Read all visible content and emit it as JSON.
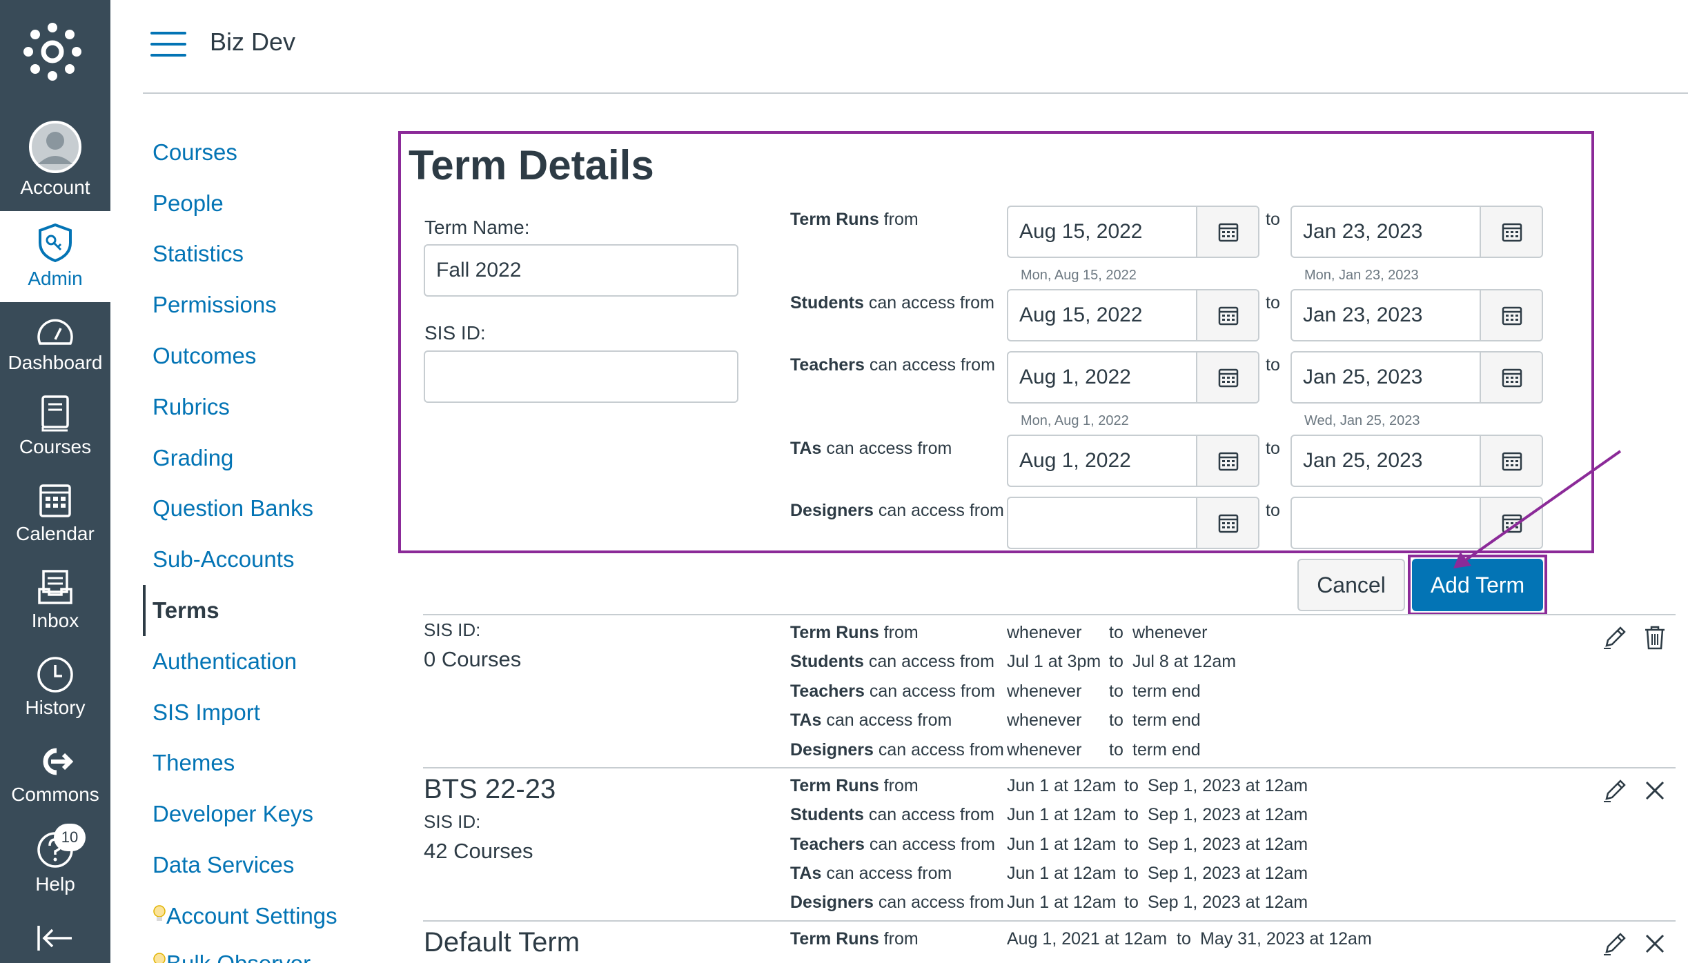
{
  "global_nav": {
    "items": [
      {
        "label": "Account",
        "icon": "user-avatar-icon"
      },
      {
        "label": "Admin",
        "icon": "admin-shield-icon",
        "active": true
      },
      {
        "label": "Dashboard",
        "icon": "dashboard-icon"
      },
      {
        "label": "Courses",
        "icon": "book-icon"
      },
      {
        "label": "Calendar",
        "icon": "calendar-icon"
      },
      {
        "label": "Inbox",
        "icon": "inbox-icon"
      },
      {
        "label": "History",
        "icon": "clock-icon"
      },
      {
        "label": "Commons",
        "icon": "commons-icon"
      },
      {
        "label": "Help",
        "icon": "help-icon",
        "badge": "10"
      }
    ],
    "collapse_icon": "collapse-arrow-icon"
  },
  "header": {
    "breadcrumb": "Biz Dev"
  },
  "course_nav": {
    "items": [
      {
        "label": "Courses"
      },
      {
        "label": "People"
      },
      {
        "label": "Statistics"
      },
      {
        "label": "Permissions"
      },
      {
        "label": "Outcomes"
      },
      {
        "label": "Rubrics"
      },
      {
        "label": "Grading"
      },
      {
        "label": "Question Banks"
      },
      {
        "label": "Sub-Accounts"
      },
      {
        "label": "Terms",
        "active": true
      },
      {
        "label": "Authentication"
      },
      {
        "label": "SIS Import"
      },
      {
        "label": "Themes"
      },
      {
        "label": "Developer Keys"
      },
      {
        "label": "Data Services"
      },
      {
        "label": "Account Settings",
        "prefix_icon": "lightbulb-icon"
      },
      {
        "label": "Bulk Observer",
        "prefix_icon": "lightbulb-icon"
      }
    ]
  },
  "term_form": {
    "title": "Term Details",
    "term_name_label": "Term Name:",
    "term_name_value": "Fall 2022",
    "sis_id_label": "SIS ID:",
    "sis_id_value": "",
    "to_label": "to",
    "rows": [
      {
        "bold": "Term Runs",
        "rest": " from",
        "start": "Aug 15, 2022",
        "end": "Jan 23, 2023",
        "start_hint": "Mon, Aug 15, 2022",
        "end_hint": "Mon, Jan 23, 2023"
      },
      {
        "bold": "Students",
        "rest": " can access from",
        "start": "Aug 15, 2022",
        "end": "Jan 23, 2023",
        "start_hint": "",
        "end_hint": ""
      },
      {
        "bold": "Teachers",
        "rest": " can access from",
        "start": "Aug 1, 2022",
        "end": "Jan 25, 2023",
        "start_hint": "Mon, Aug 1, 2022",
        "end_hint": "Wed, Jan 25, 2023"
      },
      {
        "bold": "TAs",
        "rest": " can access from",
        "start": "Aug 1, 2022",
        "end": "Jan 25, 2023",
        "start_hint": "",
        "end_hint": ""
      },
      {
        "bold": "Designers",
        "rest": " can access from",
        "start": "",
        "end": "",
        "start_hint": "",
        "end_hint": ""
      }
    ],
    "cancel_label": "Cancel",
    "add_label": "Add Term"
  },
  "terms": [
    {
      "name": "",
      "sis_label": "SIS ID:",
      "courses": "0 Courses",
      "action_icon": "trash-icon",
      "rows": [
        {
          "bold": "Term Runs",
          "rest": " from",
          "start": "whenever",
          "to": "to",
          "end": "whenever"
        },
        {
          "bold": "Students",
          "rest": " can access from",
          "start": "Jul 1 at 3pm",
          "to": "to",
          "end": "Jul 8 at 12am"
        },
        {
          "bold": "Teachers",
          "rest": " can access from",
          "start": "whenever",
          "to": "to",
          "end": "term end"
        },
        {
          "bold": "TAs",
          "rest": " can access from",
          "start": "whenever",
          "to": "to",
          "end": "term end"
        },
        {
          "bold": "Designers",
          "rest": " can access from",
          "start": "whenever",
          "to": "to",
          "end": "term end"
        }
      ]
    },
    {
      "name": "BTS 22-23",
      "sis_label": "SIS ID:",
      "courses": "42 Courses",
      "action_icon": "close-icon",
      "rows": [
        {
          "bold": "Term Runs",
          "rest": " from",
          "start": "Jun 1 at 12am",
          "to": "to",
          "end": "Sep 1, 2023 at 12am"
        },
        {
          "bold": "Students",
          "rest": " can access from",
          "start": "Jun 1 at 12am",
          "to": "to",
          "end": "Sep 1, 2023 at 12am"
        },
        {
          "bold": "Teachers",
          "rest": " can access from",
          "start": "Jun 1 at 12am",
          "to": "to",
          "end": "Sep 1, 2023 at 12am"
        },
        {
          "bold": "TAs",
          "rest": " can access from",
          "start": "Jun 1 at 12am",
          "to": "to",
          "end": "Sep 1, 2023 at 12am"
        },
        {
          "bold": "Designers",
          "rest": " can access from",
          "start": "Jun 1 at 12am",
          "to": "to",
          "end": "Sep 1, 2023 at 12am"
        }
      ]
    },
    {
      "name": "Default Term",
      "sis_label": "",
      "courses": "",
      "action_icon": "close-icon",
      "rows": [
        {
          "bold": "Term Runs",
          "rest": " from",
          "start": "Aug 1, 2021 at 12am",
          "to": "to",
          "end": "May 31, 2023 at 12am"
        }
      ]
    }
  ],
  "colors": {
    "nav_bg": "#394b58",
    "link": "#0374b5",
    "highlight": "#8b2a98",
    "primary_button": "#0374b5"
  }
}
